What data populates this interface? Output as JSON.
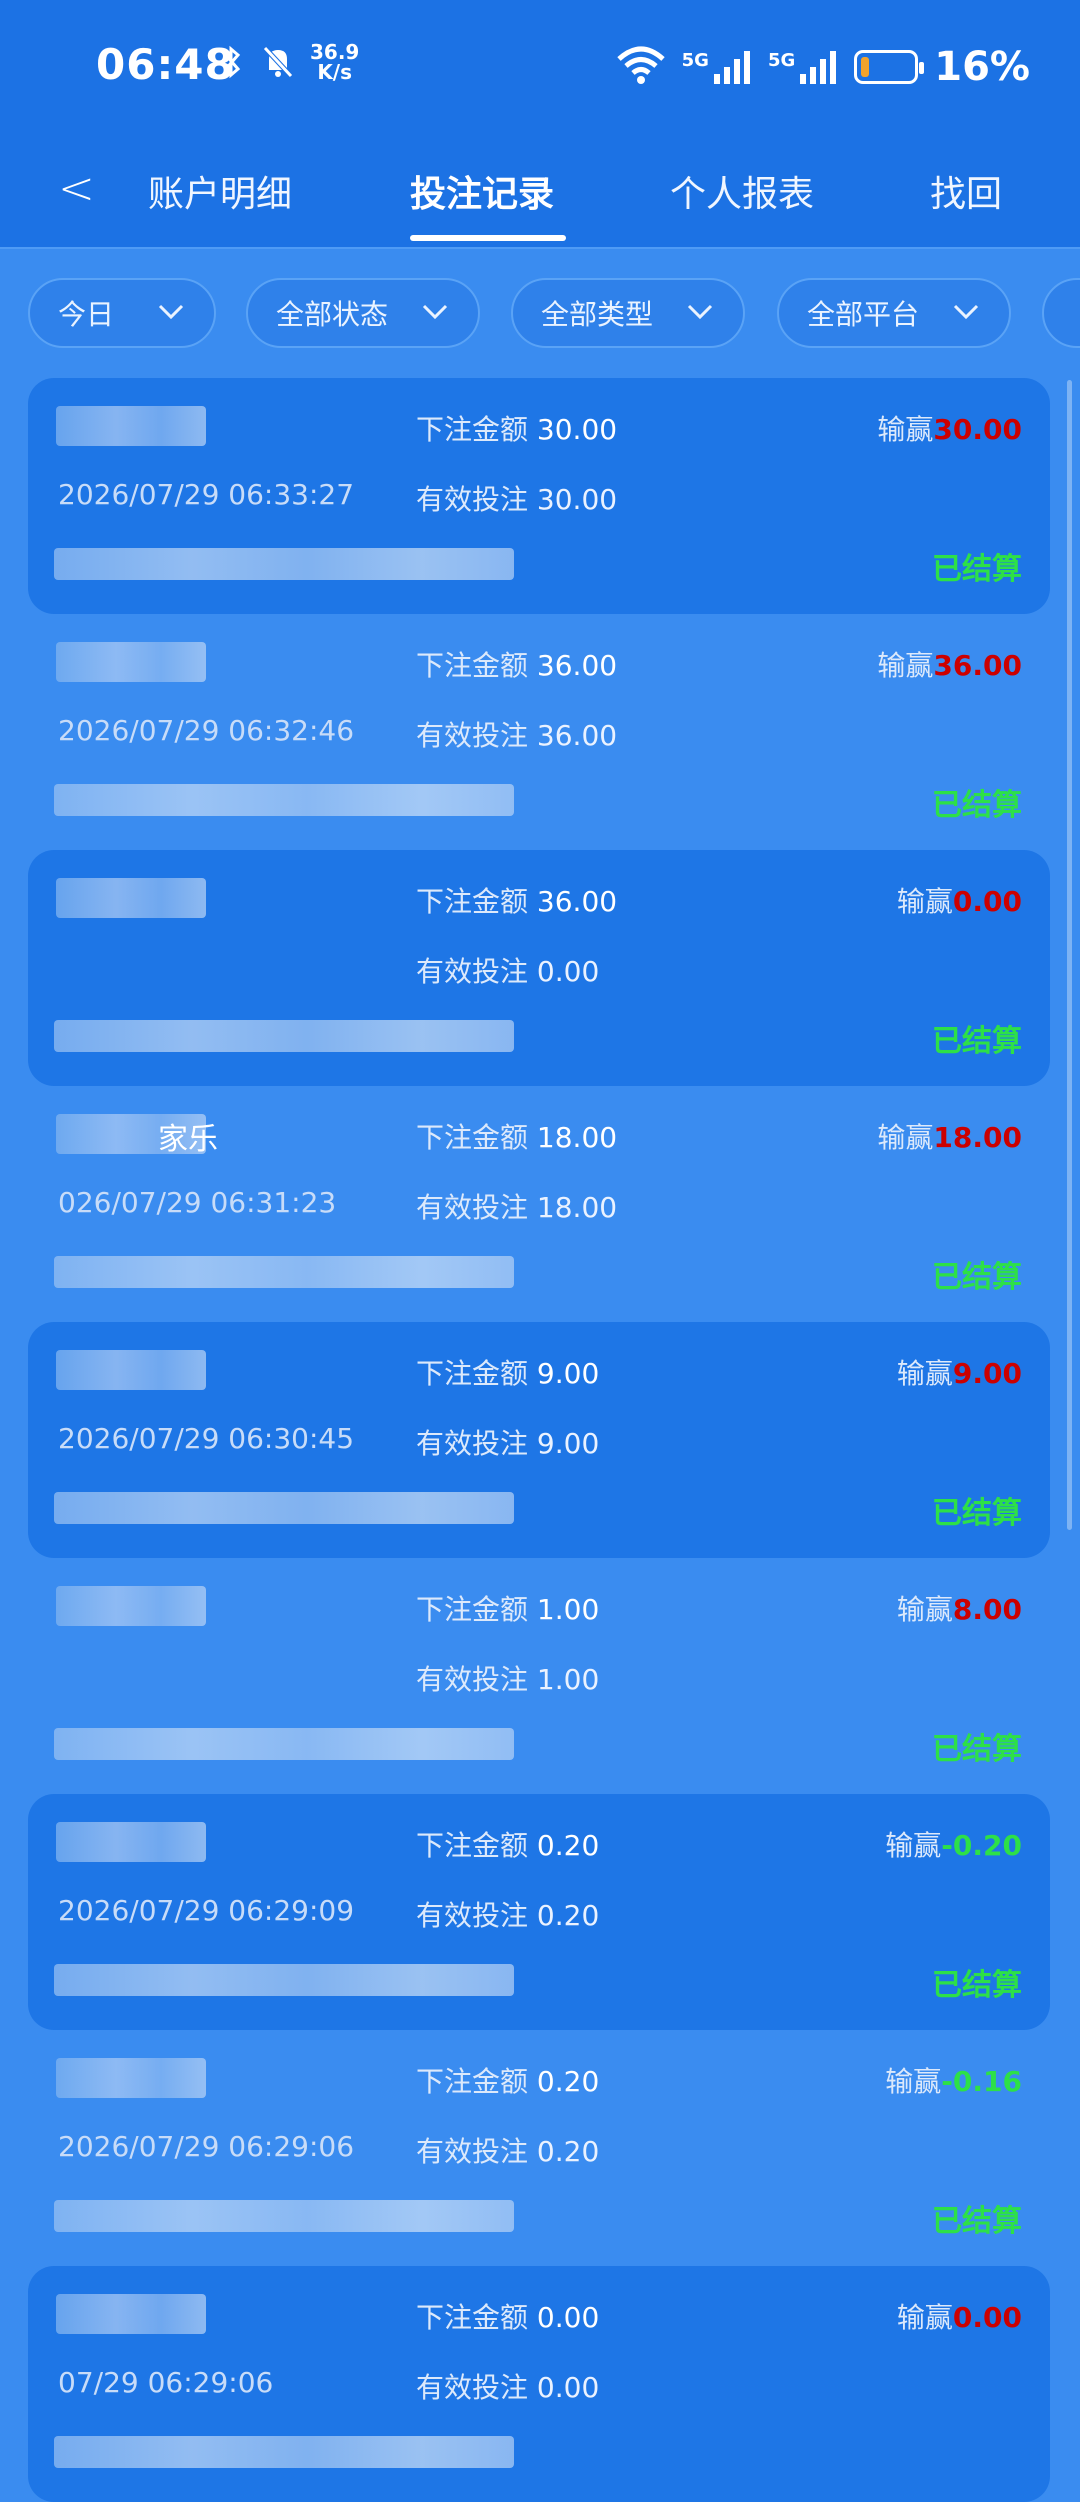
{
  "status_bar": {
    "time": "06:48",
    "net_speed_value": "36.9",
    "net_speed_unit": "K/s",
    "battery_percent": "16%",
    "battery_level": 0.16,
    "signal_1": "5G",
    "signal_2": "5G"
  },
  "tabs": [
    {
      "label": "账户明细"
    },
    {
      "label": "投注记录"
    },
    {
      "label": "个人报表"
    },
    {
      "label": "找回"
    }
  ],
  "filters": [
    {
      "label": "今日"
    },
    {
      "label": "全部状态"
    },
    {
      "label": "全部类型"
    },
    {
      "label": "全部平台"
    }
  ],
  "labels": {
    "bet_amount": "下注金额",
    "valid_bet": "有效投注",
    "win_loss": "输赢",
    "settled": "已结算"
  },
  "records": [
    {
      "name": "",
      "bet": "30.00",
      "win": "30.00",
      "win_sign": "pos",
      "time": "2026/07/29 06:33:27",
      "valid": "30.00",
      "status": "已结算"
    },
    {
      "name": "",
      "bet": "36.00",
      "win": "36.00",
      "win_sign": "pos",
      "time": "2026/07/29 06:32:46",
      "valid": "36.00",
      "status": "已结算"
    },
    {
      "name": "",
      "bet": "36.00",
      "win": "0.00",
      "win_sign": "pos",
      "time": "",
      "valid": "0.00",
      "status": "已结算"
    },
    {
      "name": "家乐",
      "bet": "18.00",
      "win": "18.00",
      "win_sign": "pos",
      "time": "026/07/29 06:31:23",
      "valid": "18.00",
      "status": "已结算"
    },
    {
      "name": "",
      "bet": "9.00",
      "win": "9.00",
      "win_sign": "pos",
      "time": "2026/07/29 06:30:45",
      "valid": "9.00",
      "status": "已结算"
    },
    {
      "name": "",
      "bet": "1.00",
      "win": "8.00",
      "win_sign": "pos",
      "time": "",
      "valid": "1.00",
      "status": "已结算"
    },
    {
      "name": "",
      "bet": "0.20",
      "win": "-0.20",
      "win_sign": "neg",
      "time": "2026/07/29 06:29:09",
      "valid": "0.20",
      "status": "已结算"
    },
    {
      "name": "",
      "bet": "0.20",
      "win": "-0.16",
      "win_sign": "neg",
      "time": "2026/07/29 06:29:06",
      "valid": "0.20",
      "status": "已结算"
    },
    {
      "name": "",
      "bet": "0.00",
      "win": "0.00",
      "win_sign": "pos",
      "time": "07/29 06:29:06",
      "valid": "0.00",
      "status": ""
    }
  ]
}
